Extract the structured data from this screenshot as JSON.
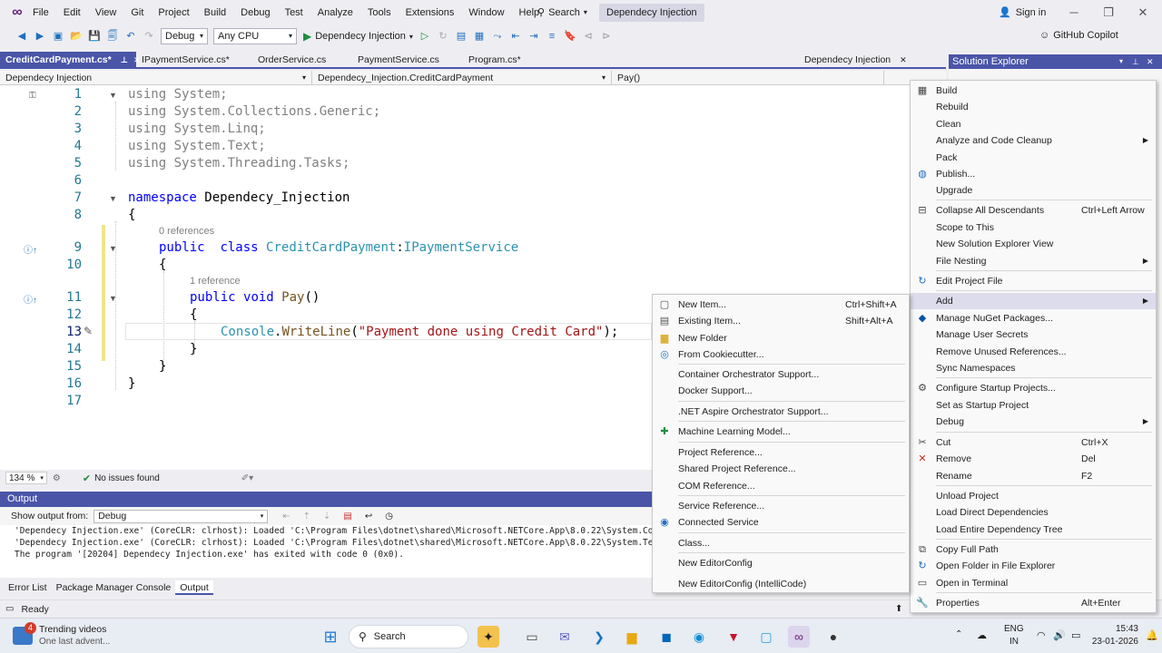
{
  "titlebar": {
    "menus": [
      "File",
      "Edit",
      "View",
      "Git",
      "Project",
      "Build",
      "Debug",
      "Test",
      "Analyze",
      "Tools",
      "Extensions",
      "Window",
      "Help"
    ],
    "search_label": "Search",
    "title": "Dependecy Injection",
    "signin": "Sign in"
  },
  "toolbar": {
    "config": "Debug",
    "platform": "Any CPU",
    "run_target": "Dependecy Injection",
    "copilot": "GitHub Copilot"
  },
  "tabs": [
    {
      "label": "CreditCardPayment.cs*",
      "active": true
    },
    {
      "label": "IPaymentService.cs*",
      "active": false
    },
    {
      "label": "OrderService.cs",
      "active": false
    },
    {
      "label": "PaymentService.cs",
      "active": false
    },
    {
      "label": "Program.cs*",
      "active": false
    }
  ],
  "tab_right": "Dependecy Injection",
  "navbar": {
    "project": "Dependecy Injection",
    "class": "Dependecy_Injection.CreditCardPayment",
    "member": "Pay()"
  },
  "code": {
    "line_numbers": [
      "1",
      "2",
      "3",
      "4",
      "5",
      "6",
      "7",
      "8",
      "9",
      "10",
      "11",
      "12",
      "13",
      "14",
      "15",
      "16",
      "17"
    ],
    "l1_kw": "using",
    "l1_rest": " System;",
    "l2_kw": "using",
    "l2_rest": " System.Collections.Generic;",
    "l3_kw": "using",
    "l3_rest": " System.Linq;",
    "l4_kw": "using",
    "l4_rest": " System.Text;",
    "l5_kw": "using",
    "l5_rest": " System.Threading.Tasks;",
    "l7_kw": "namespace",
    "l7_rest": " Dependecy_Injection",
    "l8": "{",
    "lens_class": "0 references",
    "l9_kw1": "public",
    "l9_kw2": "class",
    "l9_type": "CreditCardPayment",
    "l9_colon": ":",
    "l9_iface": "IPaymentService",
    "l10": "{",
    "lens_method": "1 reference",
    "l11_kw1": "public",
    "l11_kw2": "void",
    "l11_name": "Pay",
    "l11_paren": "()",
    "l12": "{",
    "l13_type": "Console",
    "l13_dot": ".",
    "l13_method": "WriteLine",
    "l13_open": "(",
    "l13_str": "\"Payment done using Credit Card\"",
    "l13_close": ");",
    "l14": "}",
    "l15": "}",
    "l16": "}"
  },
  "editor_status": {
    "zoom": "134 %",
    "issues": "No issues found"
  },
  "output": {
    "title": "Output",
    "show_from_label": "Show output from:",
    "source": "Debug",
    "lines": [
      "'Dependecy Injection.exe' (CoreCLR: clrhost): Loaded 'C:\\Program Files\\dotnet\\shared\\Microsoft.NETCore.App\\8.0.22\\System.Collections",
      "'Dependecy Injection.exe' (CoreCLR: clrhost): Loaded 'C:\\Program Files\\dotnet\\shared\\Microsoft.NETCore.App\\8.0.22\\System.Text.Encodi",
      "The program '[20204] Dependecy Injection.exe' has exited with code 0 (0x0)."
    ]
  },
  "bottom_tabs": [
    "Error List",
    "Package Manager Console",
    "Output"
  ],
  "status": {
    "ready": "Ready"
  },
  "solution_explorer": {
    "title": "Solution Explorer"
  },
  "context_menu": [
    {
      "label": "Build",
      "shortcut": "",
      "icon": "build-icon",
      "sub": false
    },
    {
      "label": "Rebuild",
      "shortcut": "",
      "icon": "",
      "sub": false
    },
    {
      "label": "Clean",
      "shortcut": "",
      "icon": "",
      "sub": false
    },
    {
      "label": "Analyze and Code Cleanup",
      "shortcut": "",
      "icon": "",
      "sub": true
    },
    {
      "label": "Pack",
      "shortcut": "",
      "icon": "",
      "sub": false
    },
    {
      "label": "Publish...",
      "shortcut": "",
      "icon": "globe-icon",
      "sub": false
    },
    {
      "label": "Upgrade",
      "shortcut": "",
      "icon": "",
      "sub": false
    },
    {
      "label": "Collapse All Descendants",
      "shortcut": "Ctrl+Left Arrow",
      "icon": "collapse-icon",
      "sub": false
    },
    {
      "label": "Scope to This",
      "shortcut": "",
      "icon": "",
      "sub": false
    },
    {
      "label": "New Solution Explorer View",
      "shortcut": "",
      "icon": "",
      "sub": false
    },
    {
      "label": "File Nesting",
      "shortcut": "",
      "icon": "",
      "sub": true
    },
    {
      "label": "Edit Project File",
      "shortcut": "",
      "icon": "refresh-icon",
      "sub": false
    },
    {
      "label": "Add",
      "shortcut": "",
      "icon": "",
      "sub": true
    },
    {
      "label": "Manage NuGet Packages...",
      "shortcut": "",
      "icon": "nuget-icon",
      "sub": false
    },
    {
      "label": "Manage User Secrets",
      "shortcut": "",
      "icon": "",
      "sub": false
    },
    {
      "label": "Remove Unused References...",
      "shortcut": "",
      "icon": "",
      "sub": false
    },
    {
      "label": "Sync Namespaces",
      "shortcut": "",
      "icon": "",
      "sub": false
    },
    {
      "label": "Configure Startup Projects...",
      "shortcut": "",
      "icon": "gear-icon",
      "sub": false
    },
    {
      "label": "Set as Startup Project",
      "shortcut": "",
      "icon": "",
      "sub": false
    },
    {
      "label": "Debug",
      "shortcut": "",
      "icon": "",
      "sub": true
    },
    {
      "label": "Cut",
      "shortcut": "Ctrl+X",
      "icon": "scissors-icon",
      "sub": false
    },
    {
      "label": "Remove",
      "shortcut": "Del",
      "icon": "close-icon",
      "sub": false
    },
    {
      "label": "Rename",
      "shortcut": "F2",
      "icon": "",
      "sub": false
    },
    {
      "label": "Unload Project",
      "shortcut": "",
      "icon": "",
      "sub": false
    },
    {
      "label": "Load Direct Dependencies",
      "shortcut": "",
      "icon": "",
      "sub": false
    },
    {
      "label": "Load Entire Dependency Tree",
      "shortcut": "",
      "icon": "",
      "sub": false
    },
    {
      "label": "Copy Full Path",
      "shortcut": "",
      "icon": "copy-icon",
      "sub": false
    },
    {
      "label": "Open Folder in File Explorer",
      "shortcut": "",
      "icon": "folder-refresh-icon",
      "sub": false
    },
    {
      "label": "Open in Terminal",
      "shortcut": "",
      "icon": "terminal-icon",
      "sub": false
    },
    {
      "label": "Properties",
      "shortcut": "Alt+Enter",
      "icon": "wrench-icon",
      "sub": false
    }
  ],
  "add_menu": [
    {
      "label": "New Item...",
      "shortcut": "Ctrl+Shift+A",
      "icon": "new-item-icon"
    },
    {
      "label": "Existing Item...",
      "shortcut": "Shift+Alt+A",
      "icon": "existing-item-icon"
    },
    {
      "label": "New Folder",
      "shortcut": "",
      "icon": "folder-icon"
    },
    {
      "label": "From Cookiecutter...",
      "shortcut": "",
      "icon": "cookiecutter-icon"
    },
    {
      "label": "Container Orchestrator Support...",
      "shortcut": "",
      "icon": ""
    },
    {
      "label": "Docker Support...",
      "shortcut": "",
      "icon": ""
    },
    {
      "label": ".NET Aspire Orchestrator Support...",
      "shortcut": "",
      "icon": ""
    },
    {
      "label": "Machine Learning Model...",
      "shortcut": "",
      "icon": "ml-icon"
    },
    {
      "label": "Project Reference...",
      "shortcut": "",
      "icon": ""
    },
    {
      "label": "Shared Project Reference...",
      "shortcut": "",
      "icon": ""
    },
    {
      "label": "COM Reference...",
      "shortcut": "",
      "icon": ""
    },
    {
      "label": "Service Reference...",
      "shortcut": "",
      "icon": ""
    },
    {
      "label": "Connected Service",
      "shortcut": "",
      "icon": "connected-service-icon"
    },
    {
      "label": "Class...",
      "shortcut": "",
      "icon": ""
    },
    {
      "label": "New EditorConfig",
      "shortcut": "",
      "icon": ""
    },
    {
      "label": "New EditorConfig (IntelliCode)",
      "shortcut": "",
      "icon": ""
    }
  ],
  "taskbar": {
    "notification_count": "4",
    "news_title": "Trending videos",
    "news_sub": "One last advent...",
    "search": "Search",
    "lang1": "ENG",
    "lang2": "IN",
    "time": "15:43",
    "date": "23-01-2026"
  }
}
